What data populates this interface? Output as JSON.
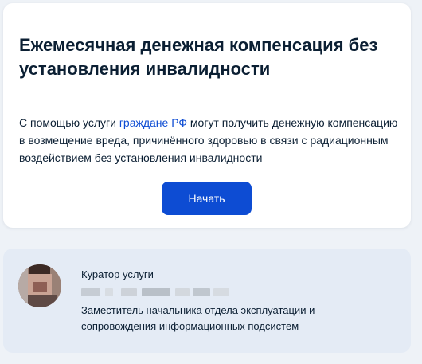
{
  "service": {
    "title": "Ежемесячная денежная компенсация без установления инвалидности",
    "description_prefix": "С помощью услуги ",
    "description_link": "граждане РФ",
    "description_suffix": " могут получить денежную компенсацию в возмещение вреда, причинённого здоровью в связи с радиационным воздействием без установления инвалидности",
    "start_button": "Начать"
  },
  "curator": {
    "label": "Куратор услуги",
    "position": "Заместитель начальника отдела эксплуатации и сопровождения информационных подсистем"
  },
  "colors": {
    "background": "#eef2f7",
    "card": "#ffffff",
    "primary": "#0d4cd3",
    "curator_card": "#e4ebf5"
  }
}
